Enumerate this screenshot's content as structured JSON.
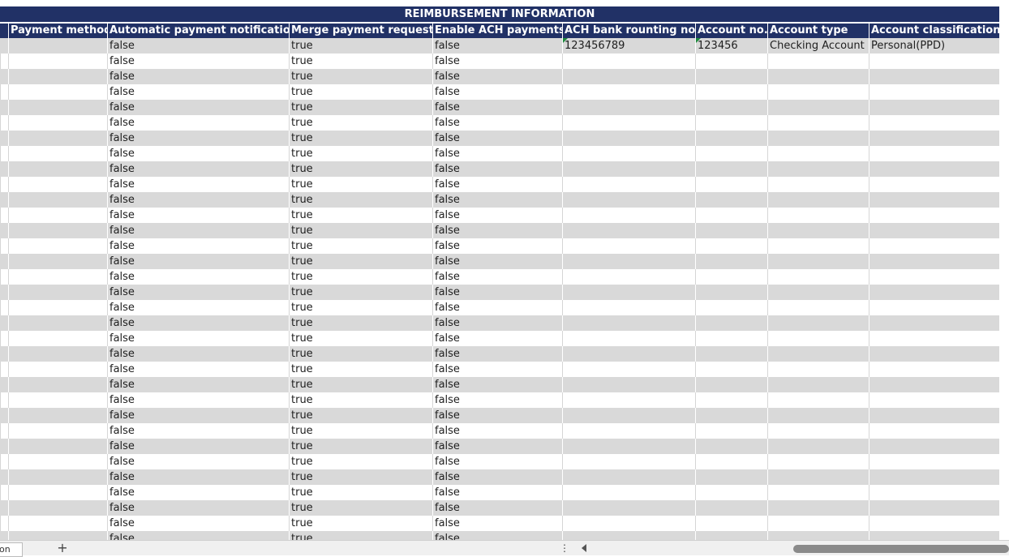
{
  "banner_title": "REIMBURSEMENT INFORMATION",
  "columns": [
    "Payment method",
    "Automatic payment notification",
    "Merge payment requests",
    "Enable ACH payments",
    "ACH bank rounting no.",
    "Account no.",
    "Account type",
    "Account classification"
  ],
  "rows": [
    {
      "auto_notify": "false",
      "merge": "true",
      "ach": "false",
      "routing": "123456789",
      "account": "123456",
      "type": "Checking Account",
      "classification": "Personal(PPD)"
    },
    {
      "auto_notify": "false",
      "merge": "true",
      "ach": "false",
      "routing": "",
      "account": "",
      "type": "",
      "classification": ""
    },
    {
      "auto_notify": "false",
      "merge": "true",
      "ach": "false",
      "routing": "",
      "account": "",
      "type": "",
      "classification": ""
    },
    {
      "auto_notify": "false",
      "merge": "true",
      "ach": "false",
      "routing": "",
      "account": "",
      "type": "",
      "classification": ""
    },
    {
      "auto_notify": "false",
      "merge": "true",
      "ach": "false",
      "routing": "",
      "account": "",
      "type": "",
      "classification": ""
    },
    {
      "auto_notify": "false",
      "merge": "true",
      "ach": "false",
      "routing": "",
      "account": "",
      "type": "",
      "classification": ""
    },
    {
      "auto_notify": "false",
      "merge": "true",
      "ach": "false",
      "routing": "",
      "account": "",
      "type": "",
      "classification": ""
    },
    {
      "auto_notify": "false",
      "merge": "true",
      "ach": "false",
      "routing": "",
      "account": "",
      "type": "",
      "classification": ""
    },
    {
      "auto_notify": "false",
      "merge": "true",
      "ach": "false",
      "routing": "",
      "account": "",
      "type": "",
      "classification": ""
    },
    {
      "auto_notify": "false",
      "merge": "true",
      "ach": "false",
      "routing": "",
      "account": "",
      "type": "",
      "classification": ""
    },
    {
      "auto_notify": "false",
      "merge": "true",
      "ach": "false",
      "routing": "",
      "account": "",
      "type": "",
      "classification": ""
    },
    {
      "auto_notify": "false",
      "merge": "true",
      "ach": "false",
      "routing": "",
      "account": "",
      "type": "",
      "classification": ""
    },
    {
      "auto_notify": "false",
      "merge": "true",
      "ach": "false",
      "routing": "",
      "account": "",
      "type": "",
      "classification": ""
    },
    {
      "auto_notify": "false",
      "merge": "true",
      "ach": "false",
      "routing": "",
      "account": "",
      "type": "",
      "classification": ""
    },
    {
      "auto_notify": "false",
      "merge": "true",
      "ach": "false",
      "routing": "",
      "account": "",
      "type": "",
      "classification": ""
    },
    {
      "auto_notify": "false",
      "merge": "true",
      "ach": "false",
      "routing": "",
      "account": "",
      "type": "",
      "classification": ""
    },
    {
      "auto_notify": "false",
      "merge": "true",
      "ach": "false",
      "routing": "",
      "account": "",
      "type": "",
      "classification": ""
    },
    {
      "auto_notify": "false",
      "merge": "true",
      "ach": "false",
      "routing": "",
      "account": "",
      "type": "",
      "classification": ""
    },
    {
      "auto_notify": "false",
      "merge": "true",
      "ach": "false",
      "routing": "",
      "account": "",
      "type": "",
      "classification": ""
    },
    {
      "auto_notify": "false",
      "merge": "true",
      "ach": "false",
      "routing": "",
      "account": "",
      "type": "",
      "classification": ""
    },
    {
      "auto_notify": "false",
      "merge": "true",
      "ach": "false",
      "routing": "",
      "account": "",
      "type": "",
      "classification": ""
    },
    {
      "auto_notify": "false",
      "merge": "true",
      "ach": "false",
      "routing": "",
      "account": "",
      "type": "",
      "classification": ""
    },
    {
      "auto_notify": "false",
      "merge": "true",
      "ach": "false",
      "routing": "",
      "account": "",
      "type": "",
      "classification": ""
    },
    {
      "auto_notify": "false",
      "merge": "true",
      "ach": "false",
      "routing": "",
      "account": "",
      "type": "",
      "classification": ""
    },
    {
      "auto_notify": "false",
      "merge": "true",
      "ach": "false",
      "routing": "",
      "account": "",
      "type": "",
      "classification": ""
    },
    {
      "auto_notify": "false",
      "merge": "true",
      "ach": "false",
      "routing": "",
      "account": "",
      "type": "",
      "classification": ""
    },
    {
      "auto_notify": "false",
      "merge": "true",
      "ach": "false",
      "routing": "",
      "account": "",
      "type": "",
      "classification": ""
    },
    {
      "auto_notify": "false",
      "merge": "true",
      "ach": "false",
      "routing": "",
      "account": "",
      "type": "",
      "classification": ""
    },
    {
      "auto_notify": "false",
      "merge": "true",
      "ach": "false",
      "routing": "",
      "account": "",
      "type": "",
      "classification": ""
    },
    {
      "auto_notify": "false",
      "merge": "true",
      "ach": "false",
      "routing": "",
      "account": "",
      "type": "",
      "classification": ""
    },
    {
      "auto_notify": "false",
      "merge": "true",
      "ach": "false",
      "routing": "",
      "account": "",
      "type": "",
      "classification": ""
    },
    {
      "auto_notify": "false",
      "merge": "true",
      "ach": "false",
      "routing": "",
      "account": "",
      "type": "",
      "classification": ""
    },
    {
      "auto_notify": "false",
      "merge": "true",
      "ach": "false",
      "routing": "",
      "account": "",
      "type": "",
      "classification": ""
    },
    {
      "auto_notify": "false",
      "merge": "true",
      "ach": "false",
      "routing": "",
      "account": "",
      "type": "",
      "classification": ""
    }
  ],
  "bottom_bar": {
    "tab_fragment": "on",
    "add_sheet_glyph": "+",
    "more_glyph": "⋮",
    "scroll_left_icon": "triangle-left-icon"
  },
  "colors": {
    "header_bg": "#213166",
    "header_text": "#ffffff",
    "row_shade": "#d9d9d9",
    "comment_marker": "#1e8a3e"
  }
}
